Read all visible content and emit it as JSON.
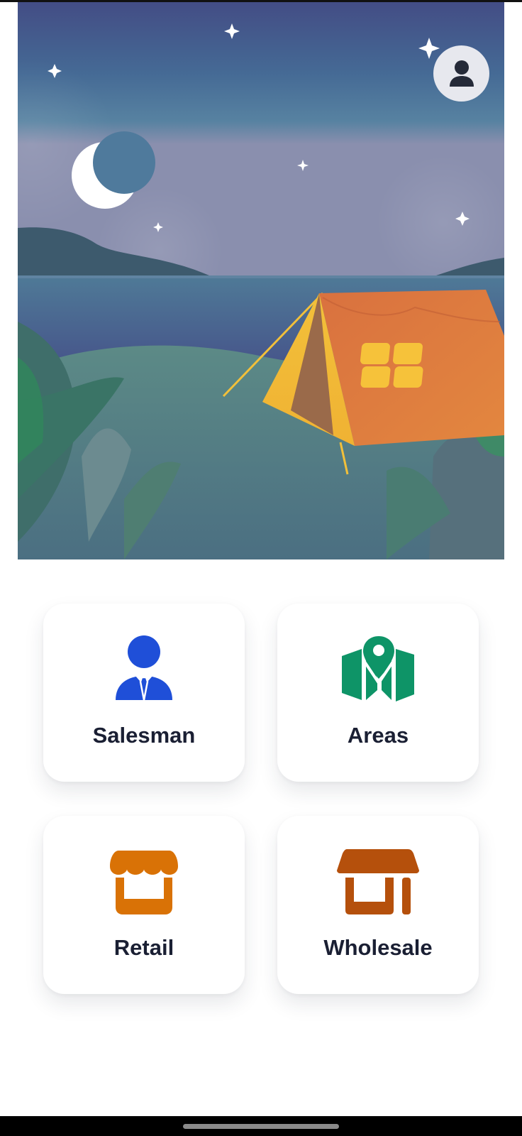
{
  "tiles": [
    {
      "label": "Salesman",
      "icon": "salesman-icon",
      "color": "#1f4fd8"
    },
    {
      "label": "Areas",
      "icon": "map-pin-icon",
      "color": "#0e9467"
    },
    {
      "label": "Retail",
      "icon": "retail-store-icon",
      "color": "#d97206"
    },
    {
      "label": "Wholesale",
      "icon": "wholesale-store-icon",
      "color": "#b5500c"
    }
  ],
  "header": {
    "profile_icon": "user-icon",
    "illustration": "night-camping-illustration"
  },
  "colors": {
    "profile_bg": "#e7e8ee",
    "label_text": "#1a1f33"
  }
}
